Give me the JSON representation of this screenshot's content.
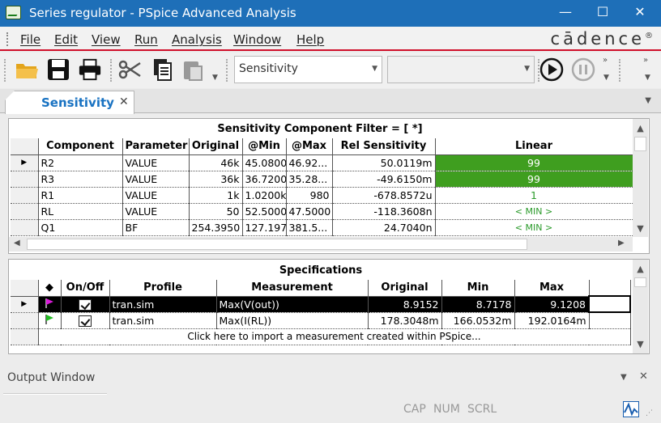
{
  "window": {
    "title": "Series regulator - PSpice Advanced Analysis"
  },
  "menu": {
    "items": [
      "File",
      "Edit",
      "View",
      "Run",
      "Analysis",
      "Window",
      "Help"
    ]
  },
  "brand": {
    "name": "cādence",
    "mark": "®"
  },
  "toolbar": {
    "analysis_select": "Sensitivity",
    "second_select": ""
  },
  "tab": {
    "label": "Sensitivity"
  },
  "sensitivity": {
    "title": "Sensitivity Component Filter = [ *]",
    "columns": [
      "Component",
      "Parameter",
      "Original",
      "@Min",
      "@Max",
      "Rel Sensitivity",
      "Linear"
    ],
    "rows": [
      {
        "component": "R2",
        "parameter": "VALUE",
        "original": "46k",
        "min": "45.0800k",
        "max": "46.92...",
        "rel": "50.0119m",
        "linear": "99",
        "linear_fraction": 1.0,
        "current": true
      },
      {
        "component": "R3",
        "parameter": "VALUE",
        "original": "36k",
        "min": "36.7200k",
        "max": "35.28...",
        "rel": "-49.6150m",
        "linear": "99",
        "linear_fraction": 1.0
      },
      {
        "component": "R1",
        "parameter": "VALUE",
        "original": "1k",
        "min": "1.0200k",
        "max": "980",
        "rel": "-678.8572u",
        "linear": "1",
        "linear_fraction": 0
      },
      {
        "component": "RL",
        "parameter": "VALUE",
        "original": "50",
        "min": "52.5000",
        "max": "47.5000",
        "rel": "-118.3608n",
        "linear": "< MIN >",
        "linear_fraction": 0
      },
      {
        "component": "Q1",
        "parameter": "BF",
        "original": "254.3950",
        "min": "127.1975",
        "max": "381.5...",
        "rel": "24.7040n",
        "linear": "< MIN >",
        "linear_fraction": 0
      }
    ]
  },
  "specs": {
    "title": "Specifications",
    "columns": [
      "◆",
      "On/Off",
      "Profile",
      "Measurement",
      "Original",
      "Min",
      "Max"
    ],
    "rows": [
      {
        "flag_color": "#d81ad8",
        "profile": "tran.sim",
        "measurement": "Max(V(out))",
        "original": "8.9152",
        "min": "8.7178",
        "max": "9.1208"
      },
      {
        "flag_color": "#22bb22",
        "profile": "tran.sim",
        "measurement": "Max(I(RL))",
        "original": "178.3048m",
        "min": "166.0532m",
        "max": "192.0164m"
      }
    ],
    "import_hint": "Click here to import a measurement created within PSpice..."
  },
  "output": {
    "title": "Output Window"
  },
  "status": {
    "cap": "CAP",
    "num": "NUM",
    "scrl": "SCRL"
  }
}
